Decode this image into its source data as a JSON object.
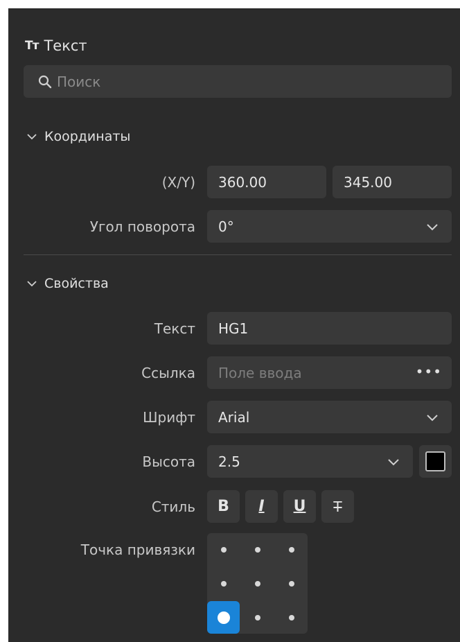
{
  "panel": {
    "title": "Текст",
    "title_icon": "text-type-icon"
  },
  "search": {
    "placeholder": "Поиск"
  },
  "coordinates": {
    "section_label": "Координаты",
    "xy_label": "(X/Y)",
    "x_value": "360.00",
    "y_value": "345.00",
    "rotation_label": "Угол поворота",
    "rotation_value": "0°"
  },
  "properties": {
    "section_label": "Свойства",
    "text_label": "Текст",
    "text_value": "HG1",
    "link_label": "Ссылка",
    "link_placeholder": "Поле ввода",
    "link_more": "•••",
    "font_label": "Шрифт",
    "font_value": "Arial",
    "height_label": "Высота",
    "height_value": "2.5",
    "text_color": "#000000",
    "style_label": "Стиль",
    "style_buttons": [
      "B",
      "I",
      "U",
      "T"
    ],
    "anchor_label": "Точка привязки",
    "anchor_selected": "bottom-left"
  },
  "colors": {
    "panel_bg": "#2b2b2b",
    "field_bg": "#393939",
    "accent": "#1a84d8"
  }
}
